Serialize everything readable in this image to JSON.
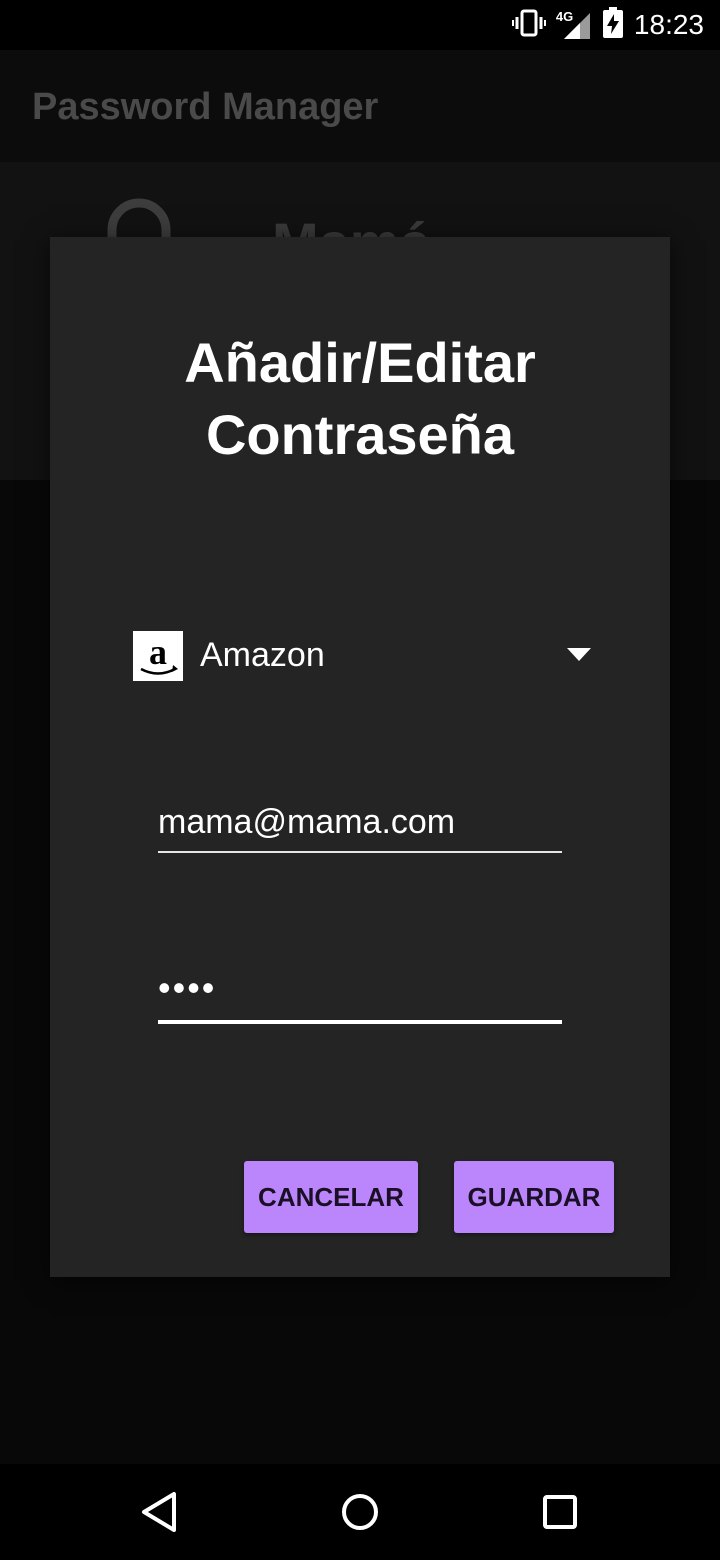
{
  "status_bar": {
    "time": "18:23",
    "network": "4G",
    "icons": [
      "vibrate-icon",
      "signal-icon",
      "battery-charging-icon"
    ]
  },
  "app_bar": {
    "title": "Password Manager"
  },
  "background_card": {
    "name": "Mamá",
    "icon": "lock-icon"
  },
  "dialog": {
    "title_line1": "Añadir/Editar",
    "title_line2": "Contraseña",
    "service": {
      "selected": "Amazon",
      "icon": "amazon-logo-icon"
    },
    "email": {
      "value": "mama@mama.com"
    },
    "password": {
      "value": "••••"
    },
    "cancel_label": "CANCELAR",
    "save_label": "GUARDAR"
  },
  "colors": {
    "accent": "#bb86fc",
    "dialog_bg": "#242424"
  },
  "nav_bar": {
    "icons": [
      "back-icon",
      "home-icon",
      "recents-icon"
    ]
  }
}
